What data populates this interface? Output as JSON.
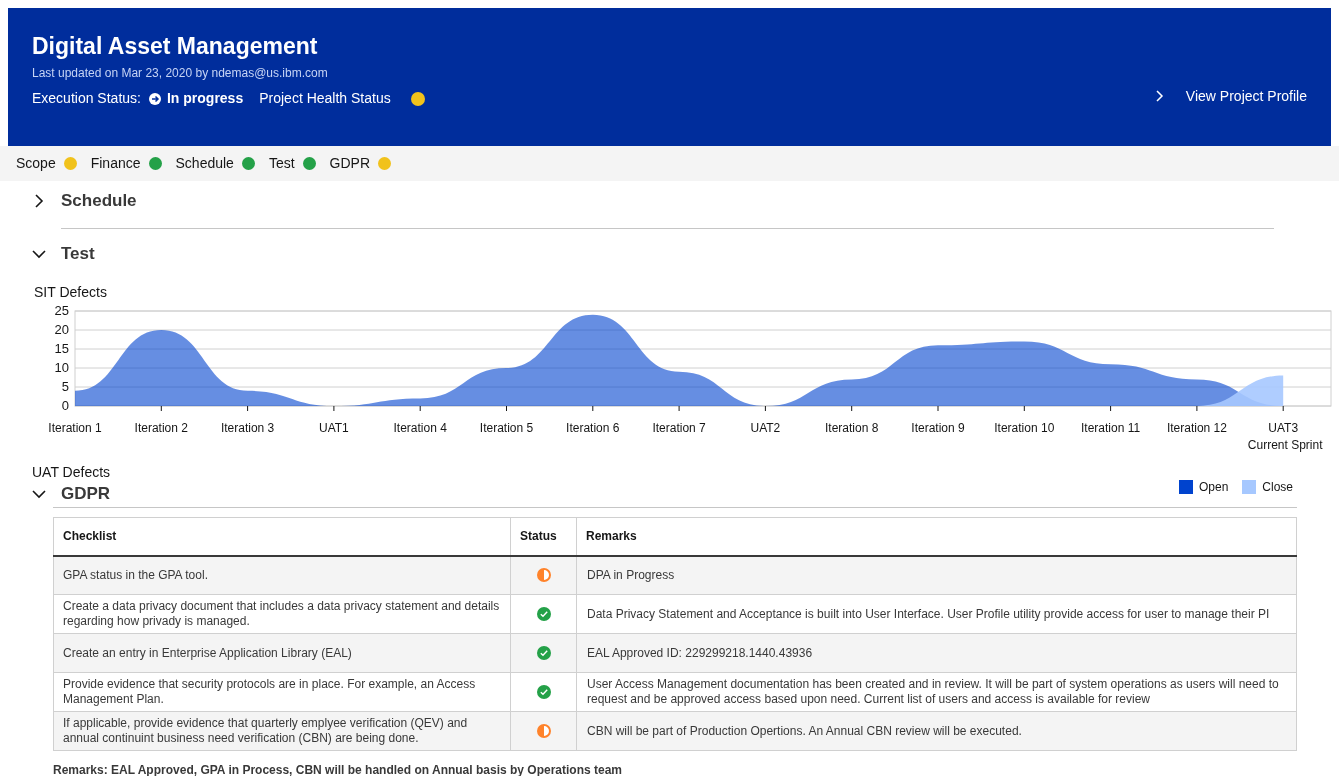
{
  "header": {
    "title": "Digital Asset Management",
    "updated": "Last updated on Mar 23, 2020 by ndemas@us.ibm.com",
    "execution_label": "Execution Status:",
    "execution_value": "In progress",
    "health_label": "Project Health Status",
    "health_dot": {
      "color": "#f1c21b"
    },
    "profile_link": "View Project Profile"
  },
  "health_items": [
    {
      "label": "Scope",
      "color": "#f1c21b"
    },
    {
      "label": "Finance",
      "color": "#24a148"
    },
    {
      "label": "Schedule",
      "color": "#24a148"
    },
    {
      "label": "Test",
      "color": "#24a148"
    },
    {
      "label": "GDPR",
      "color": "#f1c21b"
    }
  ],
  "sections": [
    {
      "title": "Schedule",
      "expanded": false
    },
    {
      "title": "Test",
      "expanded": true
    }
  ],
  "sit_title": "SIT Defects",
  "chart_data": {
    "type": "area",
    "categories": [
      "Iteration 1",
      "Iteration 2",
      "Iteration 3",
      "UAT1",
      "Iteration 4",
      "Iteration 5",
      "Iteration 6",
      "Iteration 7",
      "UAT2",
      "Iteration 8",
      "Iteration 9",
      "Iteration 10",
      "Iteration 11",
      "Iteration 12",
      "UAT3\nCurrent Sprint"
    ],
    "series": [
      {
        "name": "Open",
        "color": "#0043ce",
        "values": [
          4,
          20,
          4,
          0,
          2,
          10,
          24,
          9,
          0,
          7,
          16,
          17,
          11,
          7,
          0
        ]
      },
      {
        "name": "Close",
        "color": "#a6c8ff",
        "values": [
          null,
          null,
          null,
          null,
          null,
          null,
          null,
          null,
          null,
          null,
          null,
          null,
          null,
          0,
          8
        ]
      }
    ],
    "ylim": [
      0,
      25
    ],
    "grid": true,
    "yticks": [
      0,
      5,
      10,
      15,
      20,
      25
    ]
  },
  "uat_title": "UAT Defects",
  "gdpr": {
    "title": "GDPR",
    "expanded": true,
    "columns": [
      "Checklist",
      "Status",
      "Remarks"
    ],
    "rows": [
      {
        "checklist": "GPA status in the GPA tool.",
        "kind": "in_progress",
        "remarks": "DPA in Progress"
      },
      {
        "checklist": "Create a data privacy document that includes a data privacy statement and details regarding how privady is managed.",
        "kind": "complete",
        "remarks": "Data Privacy Statement and Acceptance is built into User Interface. User Profile utility provide access for user to manage their PI"
      },
      {
        "checklist": "Create an entry in Enterprise Application Library (EAL)",
        "kind": "complete",
        "remarks": "EAL Approved ID: 229299218.1440.43936"
      },
      {
        "checklist": "Provide evidence that security protocols are in place. For example, an Access Management Plan.",
        "kind": "complete",
        "remarks": "User Access Management documentation has been created and in review. It will be part of system operations as users will need to request and be approved access based upon need. Current list of users and access is available for review"
      },
      {
        "checklist": "If applicable, provide evidence that quarterly emplyee verification (QEV) and annual continuint business need verification (CBN) are being done.",
        "kind": "in_progress",
        "remarks": "CBN will be part of Production Opertions. An Annual CBN review will be executed."
      }
    ],
    "note": "Remarks: EAL Approved, GPA in Process, CBN will be handled on Annual basis by Operations team"
  }
}
